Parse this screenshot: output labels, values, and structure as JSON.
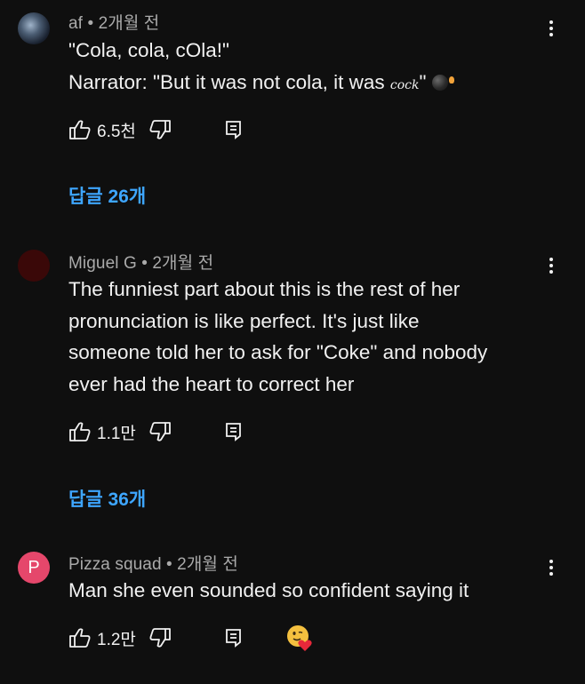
{
  "comments": [
    {
      "author": "af",
      "time": "2개월 전",
      "text_lines": [
        "\"Cola, cola, cOla!\""
      ],
      "narrator_prefix": "Narrator: \"But it was not cola, it was ",
      "narrator_cursive": "cock",
      "narrator_suffix": "\"",
      "likes": "6.5천",
      "replies_label": "답글 26개"
    },
    {
      "author": "Miguel G",
      "time": "2개월 전",
      "text_lines": [
        "The funniest part about this is the rest of her",
        "pronunciation is like perfect. It's just like",
        "someone told her to ask for \"Coke\" and nobody",
        "ever had the heart to correct her"
      ],
      "likes": "1.1만",
      "replies_label": "답글 36개"
    },
    {
      "author": "Pizza squad",
      "avatar_letter": "P",
      "time": "2개월 전",
      "text_lines": [
        "Man she even sounded so confident saying it"
      ],
      "likes": "1.2만"
    }
  ],
  "meta_separator": "•",
  "colors": {
    "background": "#0f0f0f",
    "text": "#f1f1f1",
    "meta": "#aaaaaa",
    "link": "#3ea6ff",
    "avatar_pizza": "#e5476b"
  },
  "icons": {
    "like": "thumbs-up-icon",
    "dislike": "thumbs-down-icon",
    "reply": "reply-icon",
    "more": "more-vertical-icon",
    "bomb": "bomb-emoji-icon",
    "creator_heart": "creator-heart-icon"
  }
}
